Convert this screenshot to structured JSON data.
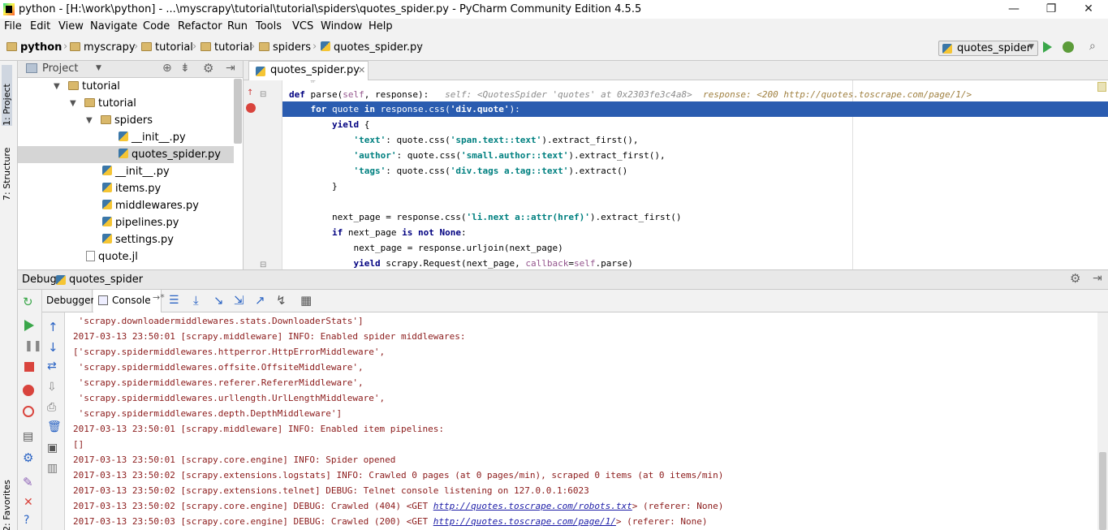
{
  "window": {
    "title": "python - [H:\\work\\python] - ...\\myscrapy\\tutorial\\tutorial\\spiders\\quotes_spider.py - PyCharm Community Edition 4.5.5",
    "minimize": "—",
    "maximize": "❐",
    "close": "✕"
  },
  "menu": [
    "File",
    "Edit",
    "View",
    "Navigate",
    "Code",
    "Refactor",
    "Run",
    "Tools",
    "VCS",
    "Window",
    "Help"
  ],
  "breadcrumb": [
    "python",
    "myscrapy",
    "tutorial",
    "tutorial",
    "spiders",
    "quotes_spider.py"
  ],
  "run_config": "quotes_spider",
  "left_stripe": {
    "project": "1: Project",
    "structure": "7: Structure",
    "favorites": "2: Favorites"
  },
  "project_panel": {
    "title": "Project",
    "tree": [
      {
        "label": "tutorial",
        "type": "folder"
      },
      {
        "label": "tutorial",
        "type": "folder"
      },
      {
        "label": "spiders",
        "type": "folder"
      },
      {
        "label": "__init__.py",
        "type": "py"
      },
      {
        "label": "quotes_spider.py",
        "type": "py"
      },
      {
        "label": "__init__.py",
        "type": "py"
      },
      {
        "label": "items.py",
        "type": "py"
      },
      {
        "label": "middlewares.py",
        "type": "py"
      },
      {
        "label": "pipelines.py",
        "type": "py"
      },
      {
        "label": "settings.py",
        "type": "py"
      },
      {
        "label": "quote.jl",
        "type": "file"
      }
    ]
  },
  "editor": {
    "tab": "quotes_spider.py",
    "hint_self": "self: <QuotesSpider 'quotes' at 0x2303fe3c4a8>",
    "hint_response": "response: <200 http://quotes.toscrape.com/page/1/>"
  },
  "debug": {
    "label": "Debug",
    "config": "quotes_spider",
    "tab_debugger": "Debugger",
    "tab_console": "Console",
    "console_lines": [
      " 'scrapy.downloadermiddlewares.stats.DownloaderStats']",
      "2017-03-13 23:50:01 [scrapy.middleware] INFO: Enabled spider middlewares:",
      "['scrapy.spidermiddlewares.httperror.HttpErrorMiddleware',",
      " 'scrapy.spidermiddlewares.offsite.OffsiteMiddleware',",
      " 'scrapy.spidermiddlewares.referer.RefererMiddleware',",
      " 'scrapy.spidermiddlewares.urllength.UrlLengthMiddleware',",
      " 'scrapy.spidermiddlewares.depth.DepthMiddleware']",
      "2017-03-13 23:50:01 [scrapy.middleware] INFO: Enabled item pipelines:",
      "[]",
      "2017-03-13 23:50:01 [scrapy.core.engine] INFO: Spider opened",
      "2017-03-13 23:50:02 [scrapy.extensions.logstats] INFO: Crawled 0 pages (at 0 pages/min), scraped 0 items (at 0 items/min)",
      "2017-03-13 23:50:02 [scrapy.extensions.telnet] DEBUG: Telnet console listening on 127.0.0.1:6023"
    ],
    "crawl_lines": [
      {
        "prefix": "2017-03-13 23:50:02 [scrapy.core.engine] DEBUG: Crawled (404) <GET ",
        "url": "http://quotes.toscrape.com/robots.txt",
        "suffix": "> (referer: None)"
      },
      {
        "prefix": "2017-03-13 23:50:03 [scrapy.core.engine] DEBUG: Crawled (200) <GET ",
        "url": "http://quotes.toscrape.com/page/1/",
        "suffix": "> (referer: None)"
      }
    ]
  }
}
